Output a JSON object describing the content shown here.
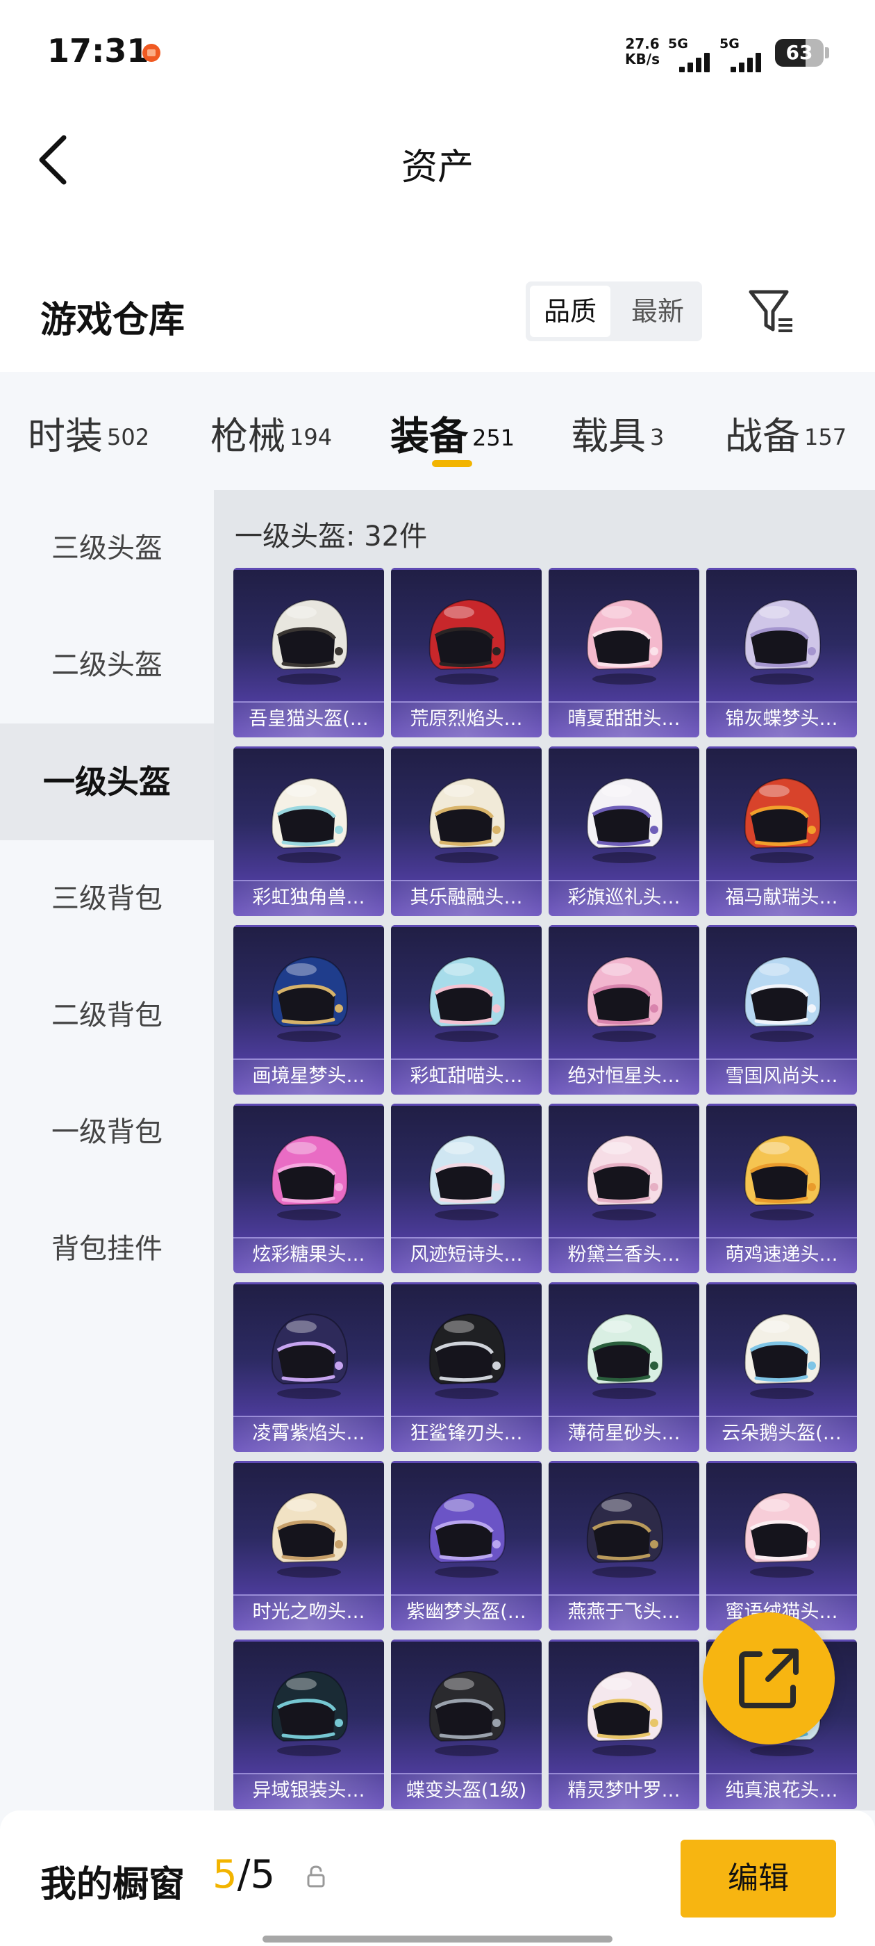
{
  "status_bar": {
    "time": "17:31",
    "speed_value": "27.6",
    "speed_unit": "KB/s",
    "sim1": "5G",
    "sim2": "5G",
    "battery": "63"
  },
  "header": {
    "back_icon": "chevron-left-icon",
    "title": "资产"
  },
  "section": {
    "title": "游戏仓库",
    "sort_options": [
      "品质",
      "最新"
    ],
    "sort_selected": "品质",
    "filter_icon": "filter-funnel-icon"
  },
  "tabs": [
    {
      "name": "时装",
      "count": "502"
    },
    {
      "name": "枪械",
      "count": "194"
    },
    {
      "name": "装备",
      "count": "251",
      "active": true
    },
    {
      "name": "载具",
      "count": "3"
    },
    {
      "name": "战备",
      "count": "157"
    }
  ],
  "sidebar": [
    {
      "label": "三级头盔"
    },
    {
      "label": "二级头盔"
    },
    {
      "label": "一级头盔",
      "active": true
    },
    {
      "label": "三级背包"
    },
    {
      "label": "二级背包"
    },
    {
      "label": "一级背包"
    },
    {
      "label": "背包挂件"
    }
  ],
  "content": {
    "title": "一级头盔: 32件",
    "items": [
      {
        "name": "吾皇猫头盔(…",
        "colors": [
          "#e8e6df",
          "#3a3633"
        ]
      },
      {
        "name": "荒原烈焰头…",
        "colors": [
          "#c8272b",
          "#2a2424"
        ]
      },
      {
        "name": "晴夏甜甜头…",
        "colors": [
          "#f4b9cd",
          "#fbe2ea"
        ]
      },
      {
        "name": "锦灰蝶梦头…",
        "colors": [
          "#cfc6e8",
          "#a596cf"
        ]
      },
      {
        "name": "彩虹独角兽…",
        "colors": [
          "#f5f1e6",
          "#9ad8e0"
        ]
      },
      {
        "name": "其乐融融头…",
        "colors": [
          "#f1ead8",
          "#d9b46a"
        ]
      },
      {
        "name": "彩旗巡礼头…",
        "colors": [
          "#f4f2f6",
          "#6f5fb8"
        ]
      },
      {
        "name": "福马献瑞头…",
        "colors": [
          "#d8432b",
          "#f2a02c"
        ]
      },
      {
        "name": "画境星梦头…",
        "colors": [
          "#1f3d8c",
          "#d7b36a"
        ]
      },
      {
        "name": "彩虹甜喵头…",
        "colors": [
          "#a7dcea",
          "#f4c3d2"
        ]
      },
      {
        "name": "绝对恒星头…",
        "colors": [
          "#f2b6cf",
          "#d884ad"
        ]
      },
      {
        "name": "雪国风尚头…",
        "colors": [
          "#b7d8f2",
          "#f2f5fb"
        ]
      },
      {
        "name": "炫彩糖果头…",
        "colors": [
          "#e96cc4",
          "#f6a8e0"
        ]
      },
      {
        "name": "风迹短诗头…",
        "colors": [
          "#cfe6f2",
          "#f1d9e4"
        ]
      },
      {
        "name": "粉黛兰香头…",
        "colors": [
          "#f6dde6",
          "#e6b0c4"
        ]
      },
      {
        "name": "萌鸡速递头…",
        "colors": [
          "#f5c451",
          "#e99b2c"
        ]
      },
      {
        "name": "凌霄紫焰头…",
        "colors": [
          "#2e2a5a",
          "#c6a4f0"
        ]
      },
      {
        "name": "狂鲨锋刃头…",
        "colors": [
          "#1f2023",
          "#cfd3da"
        ]
      },
      {
        "name": "薄荷星砂头…",
        "colors": [
          "#d9efe3",
          "#2a5e3c"
        ]
      },
      {
        "name": "云朵鹅头盔(…",
        "colors": [
          "#f3f0e6",
          "#7fc5e6"
        ]
      },
      {
        "name": "时光之吻头…",
        "colors": [
          "#f1e2c4",
          "#c7a06a"
        ]
      },
      {
        "name": "紫幽梦头盔(…",
        "colors": [
          "#6b54c6",
          "#b9a6f0"
        ]
      },
      {
        "name": "燕燕于飞头…",
        "colors": [
          "#2d2a48",
          "#b99a5c"
        ]
      },
      {
        "name": "蜜语绒猫头…",
        "colors": [
          "#f7cdd8",
          "#fbeef2"
        ]
      },
      {
        "name": "异域银装头…",
        "colors": [
          "#1a2b35",
          "#76c7d2"
        ]
      },
      {
        "name": "蝶变头盔(1级)",
        "colors": [
          "#2a2a2e",
          "#9aa2ad"
        ]
      },
      {
        "name": "精灵梦叶罗…",
        "colors": [
          "#f5e8ee",
          "#e8c66a"
        ]
      },
      {
        "name": "纯真浪花头…",
        "colors": [
          "#d7eef6",
          "#5fbad8"
        ]
      }
    ]
  },
  "fab": {
    "icon": "share-external-icon"
  },
  "bottom_bar": {
    "label": "我的橱窗",
    "current": "5",
    "separator": "/",
    "total": "5",
    "lock_icon": "lock-icon",
    "edit_label": "编辑"
  }
}
